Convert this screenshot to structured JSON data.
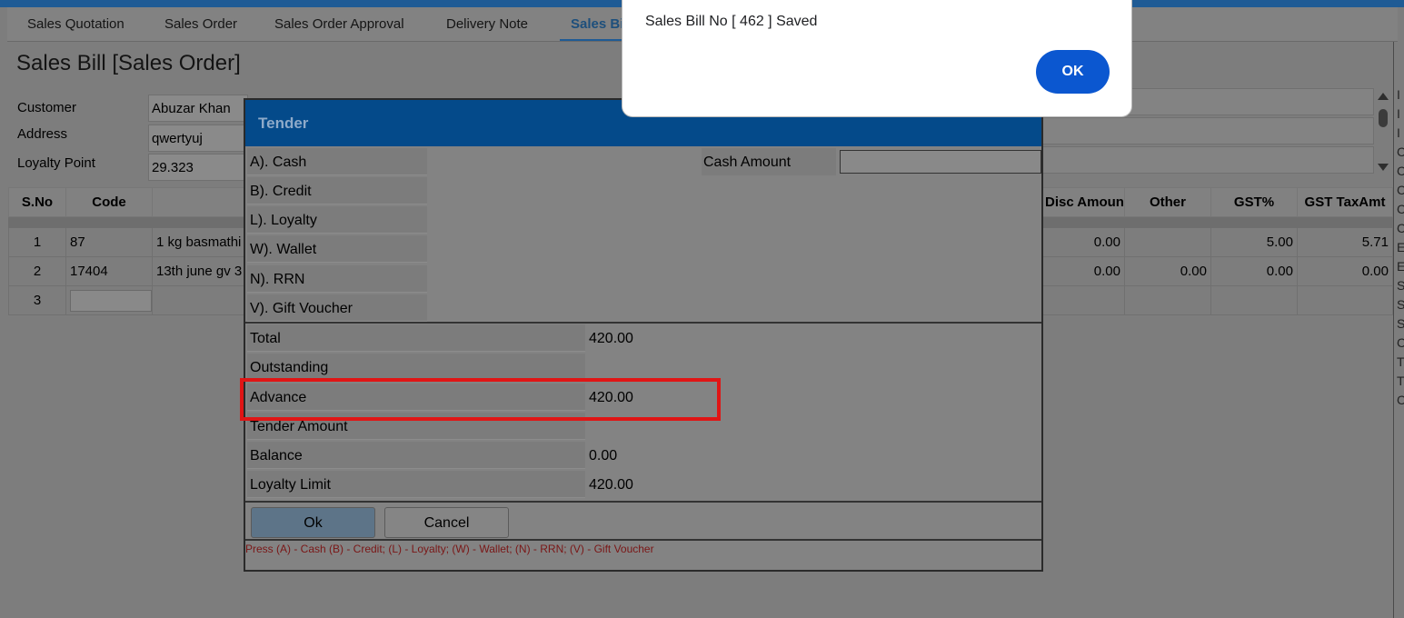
{
  "tabs": [
    {
      "label": "Sales Quotation",
      "active": false
    },
    {
      "label": "Sales Order",
      "active": false
    },
    {
      "label": "Sales Order Approval",
      "active": false
    },
    {
      "label": "Delivery Note",
      "active": false
    },
    {
      "label": "Sales Bi",
      "active": true
    }
  ],
  "page_title": "Sales Bill [Sales Order]",
  "form": {
    "customer_label": "Customer",
    "customer_value": "Abuzar Khan",
    "address_label": "Address",
    "address_value": "qwertyuj",
    "loyalty_label": "Loyalty Point",
    "loyalty_value": "29.323"
  },
  "grid": {
    "headers": {
      "sno": "S.No",
      "code": "Code",
      "disc_amount": "Disc Amount",
      "other": "Other",
      "gst_pct": "GST%",
      "gst_taxamt": "GST TaxAmt"
    },
    "rows": [
      {
        "sno": "1",
        "code": "87",
        "item": "1 kg basmathi",
        "disc_amount": "0.00",
        "other": "",
        "gst_pct": "5.00",
        "gst_taxamt": "5.71"
      },
      {
        "sno": "2",
        "code": "17404",
        "item": "13th june gv 3",
        "disc_amount": "0.00",
        "other": "0.00",
        "gst_pct": "0.00",
        "gst_taxamt": "0.00"
      },
      {
        "sno": "3",
        "code": "",
        "item": "",
        "disc_amount": "",
        "other": "",
        "gst_pct": "",
        "gst_taxamt": ""
      }
    ]
  },
  "right_edge_letters": [
    "I",
    "I",
    "I",
    "C",
    "C",
    "C",
    "C",
    "C",
    "E",
    "E",
    "S",
    "S",
    "S",
    "C",
    "T",
    "T",
    "C"
  ],
  "tender": {
    "title": "Tender",
    "modes": [
      "A). Cash",
      "B). Credit",
      "L). Loyalty",
      "W). Wallet",
      "N). RRN",
      "V). Gift Voucher"
    ],
    "cash_amount_label": "Cash Amount",
    "cash_amount_value": "",
    "summary": [
      {
        "label": "Total",
        "value": "420.00"
      },
      {
        "label": "Outstanding",
        "value": ""
      },
      {
        "label": "Advance",
        "value": "420.00"
      },
      {
        "label": "Tender Amount",
        "value": ""
      },
      {
        "label": "Balance",
        "value": "0.00"
      },
      {
        "label": "Loyalty Limit",
        "value": "420.00"
      }
    ],
    "ok_label": "Ok",
    "cancel_label": "Cancel",
    "hint": "Press (A) - Cash (B) - Credit; (L) - Loyalty; (W) - Wallet; (N) - RRN; (V) - Gift Voucher"
  },
  "alert": {
    "message": "Sales Bill No [ 462 ] Saved",
    "ok_label": "OK"
  },
  "colors": {
    "header_blue": "#044a8a",
    "alert_button": "#0b57d0",
    "highlight_red": "#e01515",
    "hint_text": "#7a1616"
  }
}
